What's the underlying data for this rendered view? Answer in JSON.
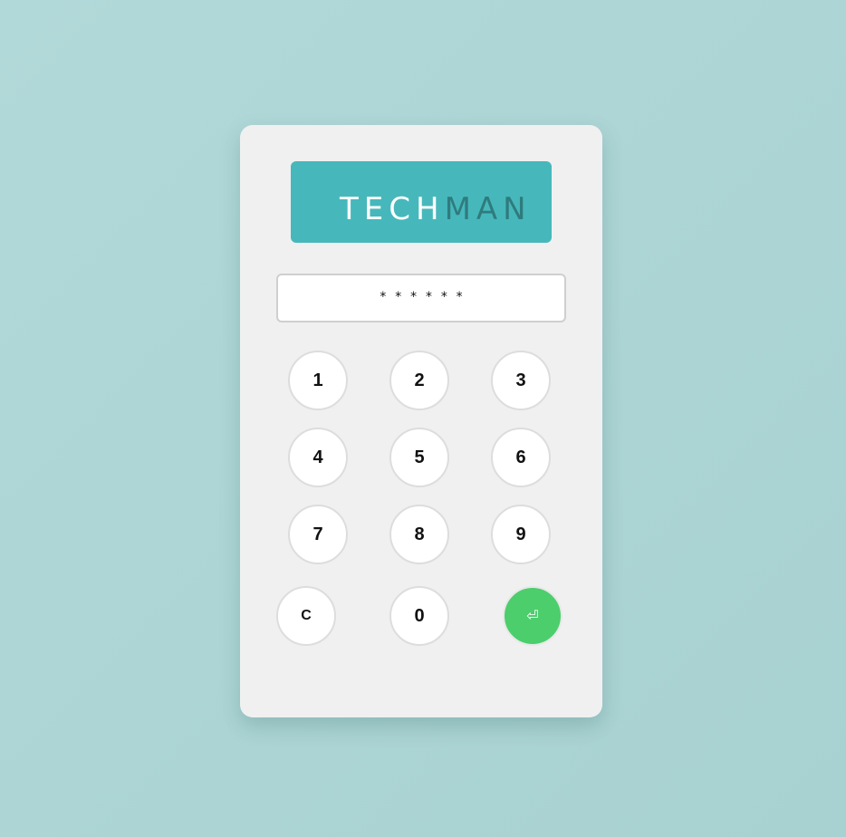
{
  "logo": {
    "part1": "TECH",
    "part2": "MAN"
  },
  "display": {
    "value": "* * * * * *"
  },
  "keypad": {
    "k1": "1",
    "k2": "2",
    "k3": "3",
    "k4": "4",
    "k5": "5",
    "k6": "6",
    "k7": "7",
    "k8": "8",
    "k9": "9",
    "clear": "C",
    "k0": "0",
    "enter": "⏎"
  },
  "colors": {
    "background": "#b0d7d7",
    "panel": "#f0f0f0",
    "logo_bg": "#46b8bb",
    "logo_accent": "#2f7b7e",
    "enter_button": "#4cce6c"
  }
}
